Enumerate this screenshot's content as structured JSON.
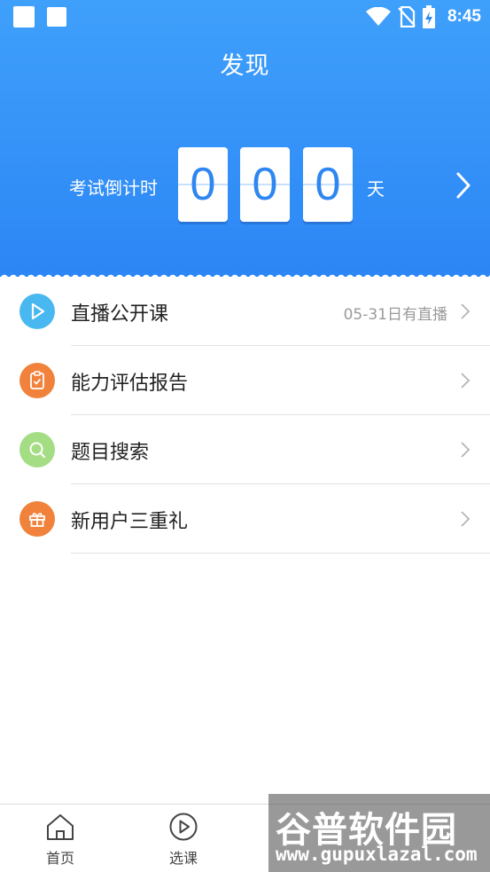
{
  "status_bar": {
    "time": "8:45",
    "icons": [
      "notification-square-icon",
      "notification-square-icon",
      "wifi-icon",
      "no-sim-icon",
      "battery-charging-icon"
    ]
  },
  "header": {
    "title": "发现"
  },
  "countdown": {
    "label": "考试倒计时",
    "digits": [
      "0",
      "0",
      "0"
    ],
    "unit": "天",
    "arrow_icon": "chevron-right-icon"
  },
  "list": {
    "items": [
      {
        "label": "直播公开课",
        "note": "05-31日有直播",
        "icon": "play-icon",
        "icon_color": "#4AB8F0"
      },
      {
        "label": "能力评估报告",
        "note": "",
        "icon": "clipboard-check-icon",
        "icon_color": "#F0823C"
      },
      {
        "label": "题目搜索",
        "note": "",
        "icon": "search-icon",
        "icon_color": "#A5DD84"
      },
      {
        "label": "新用户三重礼",
        "note": "",
        "icon": "gift-icon",
        "icon_color": "#F0823C"
      }
    ]
  },
  "bottom_nav": {
    "items": [
      {
        "label": "首页",
        "icon": "home-icon"
      },
      {
        "label": "选课",
        "icon": "play-circle-icon"
      }
    ]
  },
  "watermark": {
    "line1": "谷普软件园",
    "line2": "www.gupuxlazal.com"
  },
  "colors": {
    "header_top": "#3FA0FB",
    "header_bottom": "#2C86F5",
    "digit_text": "#2E86F0"
  }
}
